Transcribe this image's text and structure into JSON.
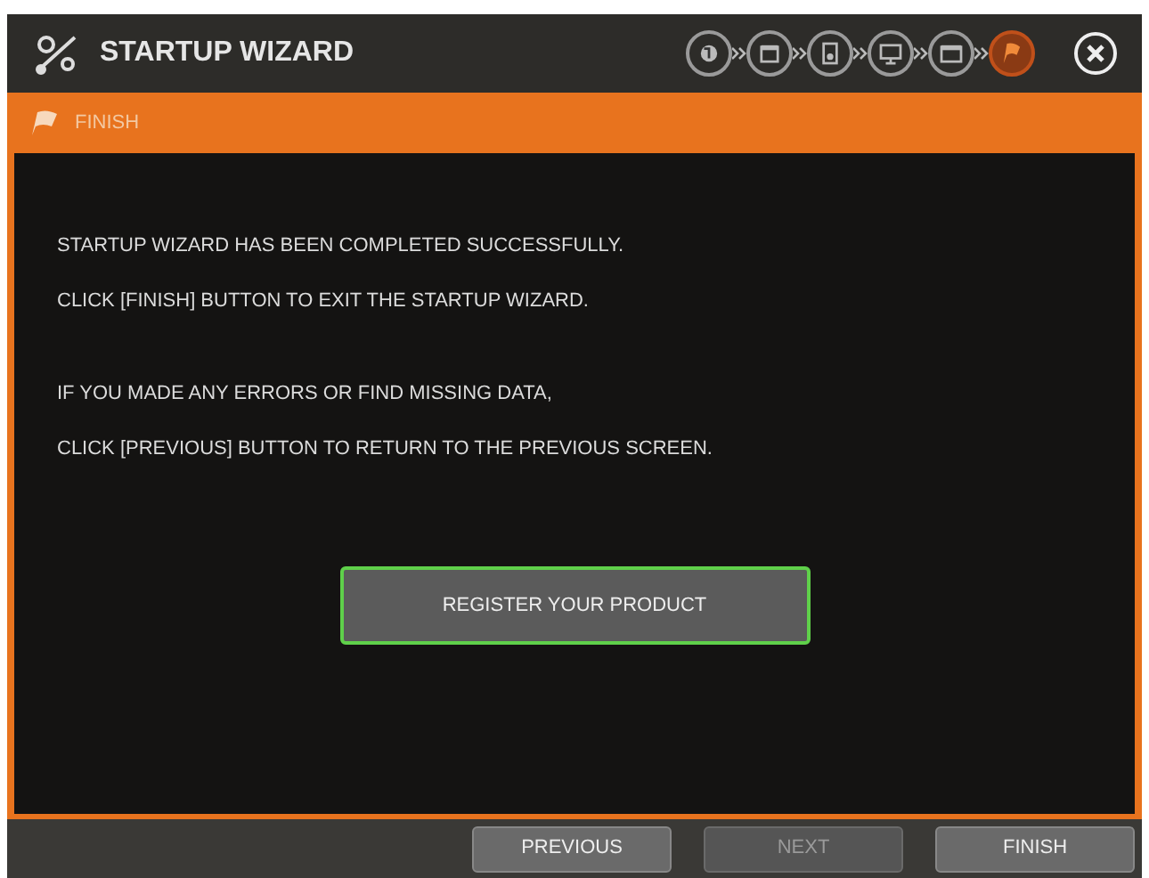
{
  "window": {
    "title": "STARTUP WIZARD"
  },
  "steps": [
    {
      "kind": "globe",
      "selected": false
    },
    {
      "kind": "calendar",
      "selected": false
    },
    {
      "kind": "disk",
      "selected": false
    },
    {
      "kind": "monitor",
      "selected": false
    },
    {
      "kind": "camera",
      "selected": false
    },
    {
      "kind": "flag",
      "selected": true
    }
  ],
  "section": {
    "title": "FINISH"
  },
  "messages": [
    "STARTUP WIZARD HAS BEEN COMPLETED SUCCESSFULLY.",
    "CLICK [FINISH] BUTTON TO EXIT THE STARTUP WIZARD.",
    "IF YOU MADE ANY ERRORS OR FIND MISSING DATA,",
    "CLICK [PREVIOUS] BUTTON TO RETURN TO THE PREVIOUS SCREEN."
  ],
  "register_button": "REGISTER YOUR PRODUCT",
  "buttons": [
    {
      "label": "PREVIOUS",
      "disabled": false
    },
    {
      "label": "NEXT",
      "disabled": true
    },
    {
      "label": "FINISH",
      "disabled": false
    }
  ]
}
